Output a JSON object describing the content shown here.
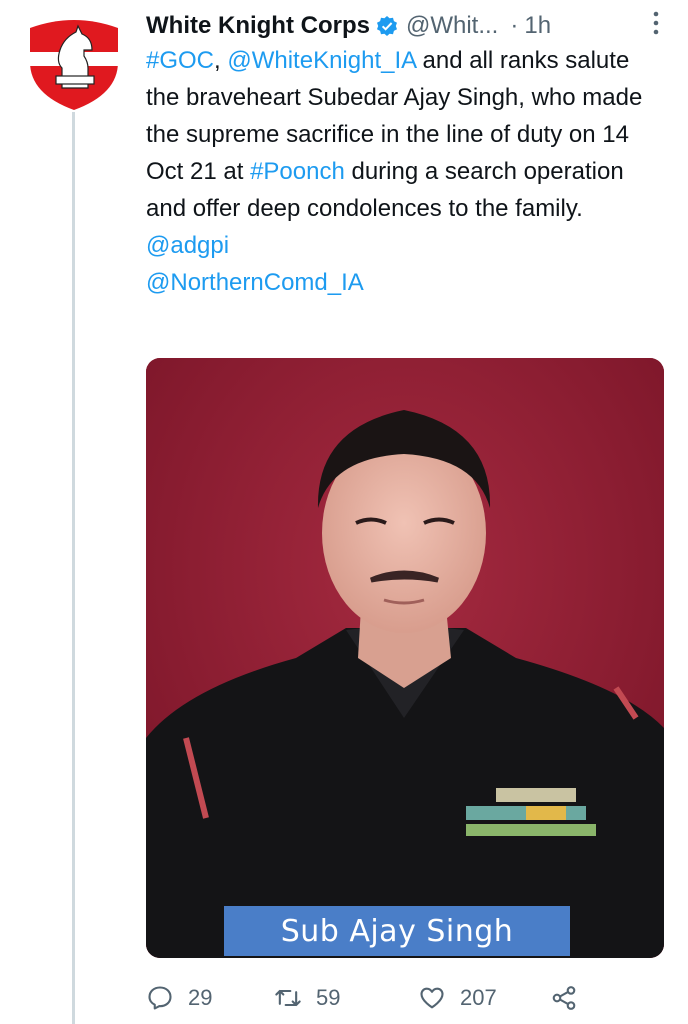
{
  "tweet": {
    "author_name": "White Knight Corps",
    "handle": "@Whit...",
    "dot": "·",
    "time": "1h",
    "text": {
      "tag_goc": "#GOC",
      "comma": ",",
      "mention_whiteknight": "@WhiteKnight_IA",
      "part1": " and all ranks salute the braveheart Subedar Ajay Singh, who made the supreme sacrifice in the line of duty on 14 Oct 21 at ",
      "tag_poonch": "#Poonch",
      "part2": " during a search operation and offer deep condolences to the family.",
      "mention_adgpi": "@adgpi",
      "mention_northern": "@NorthernComd_IA"
    },
    "photo_caption": "Sub Ajay Singh"
  },
  "actions": {
    "reply_count": "29",
    "retweet_count": "59",
    "like_count": "207"
  },
  "icons": {
    "verified": "verified-badge-icon",
    "more": "more-options-icon",
    "reply": "reply-icon",
    "retweet": "retweet-icon",
    "like": "like-icon",
    "share": "share-icon"
  },
  "colors": {
    "link": "#1d9bf0",
    "muted": "#536471",
    "photo_background": "#8d1c33",
    "caption_background": "#4a7ec8"
  }
}
